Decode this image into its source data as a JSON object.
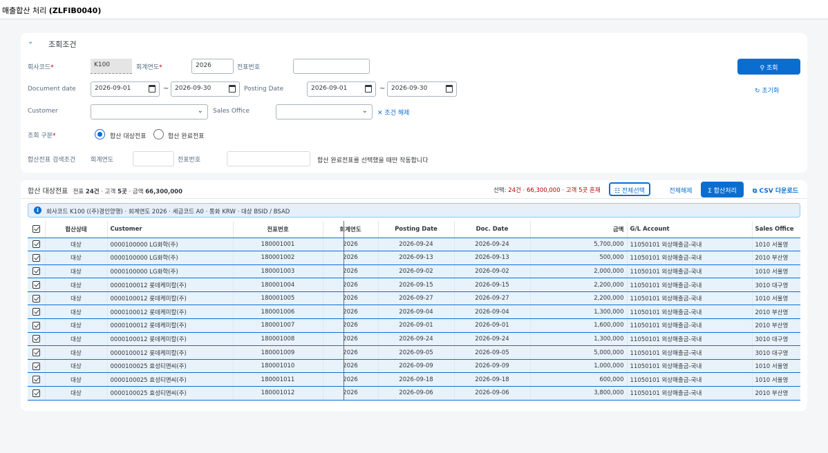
{
  "window": {
    "title_prefix": "매출합산 처리",
    "title_code": "(ZLFIB0040)"
  },
  "filter_panel": {
    "title": "조회조건",
    "company_code": {
      "label": "회사코드",
      "value": "K100"
    },
    "fiscal_year": {
      "label": "회계연도",
      "value": "2026"
    },
    "doc_no": {
      "label": "전표번호",
      "value": ""
    },
    "search_button": "조회",
    "document_date": {
      "label": "Document date",
      "from": "2026-09-01",
      "to": "2026-09-30"
    },
    "posting_date": {
      "label": "Posting Date",
      "from": "2026-09-01",
      "to": "2026-09-30"
    },
    "reset_link": "초기화",
    "customer": {
      "label": "Customer",
      "value": ""
    },
    "sales_office": {
      "label": "Sales Office",
      "value": ""
    },
    "clear_link": "조건 해제",
    "query_type": {
      "label": "조회 구분",
      "option_target": "합산 대상전표",
      "option_done": "합산 완료전표",
      "selected": "합산 대상전표"
    },
    "sum_search": {
      "label": "합산전표 검색조건",
      "year_label": "회계연도",
      "year_value": "",
      "doc_label": "전표번호",
      "doc_value": "",
      "hint": "합산 완료전표를 선택했을 때만 작동합니다"
    }
  },
  "result_panel": {
    "title": "합산 대상전표",
    "summary_prefix": "전표",
    "summary_count": "24건",
    "summary_customer_prefix": "· 고객",
    "summary_customer": "5곳",
    "summary_amount_prefix": "· 금액",
    "summary_amount": "66,300,000",
    "selection_prefix": "선택:",
    "selection_value": "24건 · 66,300,000 · 고객 5곳 혼재",
    "select_all_button": "전체선택",
    "deselect_all_button": "전체해제",
    "sum_button": "합산처리",
    "csv_button": "CSV 다운로드",
    "info": "회사코드 K100 ((주)경인양행) · 회계연도 2026 · 세금코드 A0 · 통화 KRW · 대상 BSID / BSAD",
    "columns": [
      "합산상태",
      "Customer",
      "전표번호",
      "회계연도",
      "Posting Date",
      "Doc. Date",
      "금액",
      "G/L Account",
      "Sales Office"
    ],
    "rows": [
      {
        "status": "대상",
        "customer": "0000100000 LG화학(주)",
        "doc": "180001001",
        "year": "2026",
        "posting": "2026-09-24",
        "docdate": "2026-09-24",
        "amount": "5,700,000",
        "gl": "11050101 외상매출금-국내",
        "office": "1010 서울영"
      },
      {
        "status": "대상",
        "customer": "0000100000 LG화학(주)",
        "doc": "180001002",
        "year": "2026",
        "posting": "2026-09-13",
        "docdate": "2026-09-13",
        "amount": "500,000",
        "gl": "11050101 외상매출금-국내",
        "office": "2010 부산영"
      },
      {
        "status": "대상",
        "customer": "0000100000 LG화학(주)",
        "doc": "180001003",
        "year": "2026",
        "posting": "2026-09-02",
        "docdate": "2026-09-02",
        "amount": "2,000,000",
        "gl": "11050101 외상매출금-국내",
        "office": "1010 서울영"
      },
      {
        "status": "대상",
        "customer": "0000100012 롯데케미칼(주)",
        "doc": "180001004",
        "year": "2026",
        "posting": "2026-09-15",
        "docdate": "2026-09-15",
        "amount": "2,200,000",
        "gl": "11050101 외상매출금-국내",
        "office": "3010 대구영"
      },
      {
        "status": "대상",
        "customer": "0000100012 롯데케미칼(주)",
        "doc": "180001005",
        "year": "2026",
        "posting": "2026-09-27",
        "docdate": "2026-09-27",
        "amount": "2,200,000",
        "gl": "11050101 외상매출금-국내",
        "office": "1010 서울영"
      },
      {
        "status": "대상",
        "customer": "0000100012 롯데케미칼(주)",
        "doc": "180001006",
        "year": "2026",
        "posting": "2026-09-04",
        "docdate": "2026-09-04",
        "amount": "1,300,000",
        "gl": "11050101 외상매출금-국내",
        "office": "2010 부산영"
      },
      {
        "status": "대상",
        "customer": "0000100012 롯데케미칼(주)",
        "doc": "180001007",
        "year": "2026",
        "posting": "2026-09-01",
        "docdate": "2026-09-01",
        "amount": "1,600,000",
        "gl": "11050101 외상매출금-국내",
        "office": "2010 부산영"
      },
      {
        "status": "대상",
        "customer": "0000100012 롯데케미칼(주)",
        "doc": "180001008",
        "year": "2026",
        "posting": "2026-09-24",
        "docdate": "2026-09-24",
        "amount": "1,300,000",
        "gl": "11050101 외상매출금-국내",
        "office": "3010 대구영"
      },
      {
        "status": "대상",
        "customer": "0000100012 롯데케미칼(주)",
        "doc": "180001009",
        "year": "2026",
        "posting": "2026-09-05",
        "docdate": "2026-09-05",
        "amount": "5,000,000",
        "gl": "11050101 외상매출금-국내",
        "office": "3010 대구영"
      },
      {
        "status": "대상",
        "customer": "0000100025 효성티앤씨(주)",
        "doc": "180001010",
        "year": "2026",
        "posting": "2026-09-09",
        "docdate": "2026-09-09",
        "amount": "1,000,000",
        "gl": "11050101 외상매출금-국내",
        "office": "1010 서울영"
      },
      {
        "status": "대상",
        "customer": "0000100025 효성티앤씨(주)",
        "doc": "180001011",
        "year": "2026",
        "posting": "2026-09-18",
        "docdate": "2026-09-18",
        "amount": "600,000",
        "gl": "11050101 외상매출금-국내",
        "office": "1010 서울영"
      },
      {
        "status": "대상",
        "customer": "0000100025 효성티앤씨(주)",
        "doc": "180001012",
        "year": "2026",
        "posting": "2026-09-06",
        "docdate": "2026-09-06",
        "amount": "3,800,000",
        "gl": "11050101 외상매출금-국내",
        "office": "2010 부산영"
      }
    ]
  },
  "colors": {
    "accent": "#0a6ed1",
    "status_orange": "#e9730c",
    "required_red": "#bb0000",
    "row_selected_bg": "#e8f2fb"
  }
}
